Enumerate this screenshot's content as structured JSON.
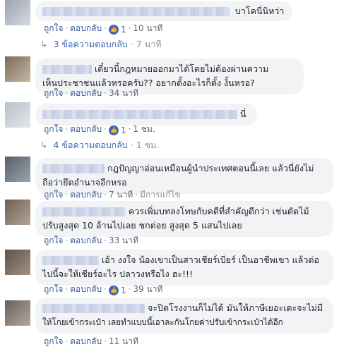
{
  "comments": [
    {
      "text": "บาโคนี่นิหว่า",
      "like": "ถูกใจ",
      "reply": "ตอบกลับ",
      "likes": "1",
      "time": "10 นาที"
    },
    {
      "text_line1": "เดี๋ยวนี้กฎหมายออกมาได้โดยไม่ต้องผ่านความ",
      "text_line2": "เห็นประชาชนแล้วหรอครับ?? อยากตั้งอะไรก็ตั้ง งั้นหรอ?",
      "like": "ถูกใจ",
      "reply": "ตอบกลับ",
      "time": "34 นาที"
    },
    {
      "text": "นี่",
      "like": "ถูกใจ",
      "reply": "ตอบกลับ",
      "likes": "1",
      "time": "1 ชม."
    },
    {
      "text_line1": "กฎปัญญาอ่อนเหมือนผู้นำประเทศตอนนี้เลย แล้วนี่ยังไม่",
      "text_line2": "ถือว่ายึดอำนาจอีกหรอ",
      "like": "ถูกใจ",
      "reply": "ตอบกลับ",
      "time": "7 นาที",
      "edited": "มีการแก้ไข"
    },
    {
      "text_line1": "ควรเพิ่มบทลงโทษกับคดีที่สำคัญดีกว่า เช่นตัดไม้",
      "text_line2": "ปรับสูงสุด 10 ล้านไปเลย ชกต่อย สูงสุด 5 แสนไปเลย",
      "like": "ถูกใจ",
      "reply": "ตอบกลับ",
      "time": "33 นาที"
    },
    {
      "text_line1": "เอ้า งงใจ น้องเขาเป็นสาวเชียร์เบียร์ เป็นอาชีพเขา แล้วต่อ",
      "text_line2": "ไปนี้จะให้เชียร์อะไร ปลาวงหรือไง ฮะ!!!",
      "like": "ถูกใจ",
      "reply": "ตอบกลับ",
      "likes": "1",
      "time": "39 นาที"
    },
    {
      "text_line1": "จะปิดโรงงานก็ไม่ได้ มันให้ภาษีเยอะเดะจะไม่มี",
      "text_line2": "ให้โกยเข้ากระเป๋า เลยทำแบบนี้เอาละกันโกยค่าปรับเข้ากระเป๋าได้อีก",
      "like": "ถูกใจ",
      "reply": "ตอบกลับ",
      "time": "11 นาที"
    }
  ],
  "replies": [
    {
      "label": "3 ข้อความตอบกลับ",
      "time": "7 นาที"
    },
    {
      "label": "4 ข้อความตอบกลับ",
      "time": "1 ชม."
    }
  ],
  "icons": {
    "like": "thumbs-up-icon",
    "reply_arrow": "reply-arrow-icon"
  },
  "colors": {
    "bubble": "#f2f3f5",
    "link": "#385898",
    "like_badge": "#4267b2",
    "meta": "#90949c"
  }
}
